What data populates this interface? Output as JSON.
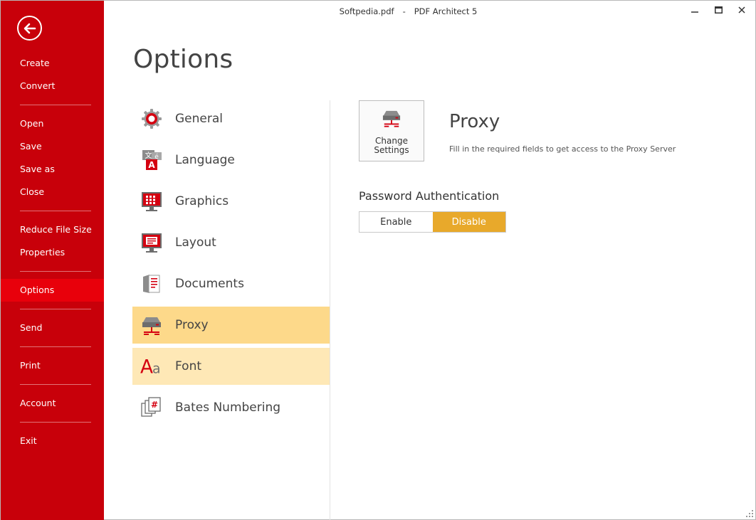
{
  "window": {
    "file_name": "Softpedia.pdf",
    "separator": "-",
    "app_name": "PDF Architect 5"
  },
  "sidebar": {
    "back_icon": "back-arrow-icon",
    "groups": [
      [
        "Create",
        "Convert"
      ],
      [
        "Open",
        "Save",
        "Save as",
        "Close"
      ],
      [
        "Reduce File Size",
        "Properties"
      ],
      [
        "Options"
      ],
      [
        "Send"
      ],
      [
        "Print"
      ],
      [
        "Account"
      ],
      [
        "Exit"
      ]
    ],
    "active": "Options",
    "colors": {
      "background": "#c8000a",
      "active": "#e8000b"
    }
  },
  "page": {
    "title": "Options"
  },
  "categories": [
    {
      "label": "General",
      "icon": "gear-icon"
    },
    {
      "label": "Language",
      "icon": "language-icon"
    },
    {
      "label": "Graphics",
      "icon": "monitor-grid-icon"
    },
    {
      "label": "Layout",
      "icon": "monitor-layout-icon"
    },
    {
      "label": "Documents",
      "icon": "documents-icon"
    },
    {
      "label": "Proxy",
      "icon": "server-icon",
      "state": "selected"
    },
    {
      "label": "Font",
      "icon": "font-icon",
      "state": "hover"
    },
    {
      "label": "Bates Numbering",
      "icon": "bates-numbering-icon"
    }
  ],
  "proxy": {
    "change_button_lines": [
      "Change",
      "Settings"
    ],
    "title": "Proxy",
    "description": "Fill in the required fields to get access to the Proxy Server",
    "password_label": "Password Authentication",
    "options": [
      "Enable",
      "Disable"
    ],
    "selected": "Disable",
    "colors": {
      "selected": "#e8a92b",
      "category_selected": "#fdd98a",
      "category_hover": "#fee8b6"
    }
  }
}
